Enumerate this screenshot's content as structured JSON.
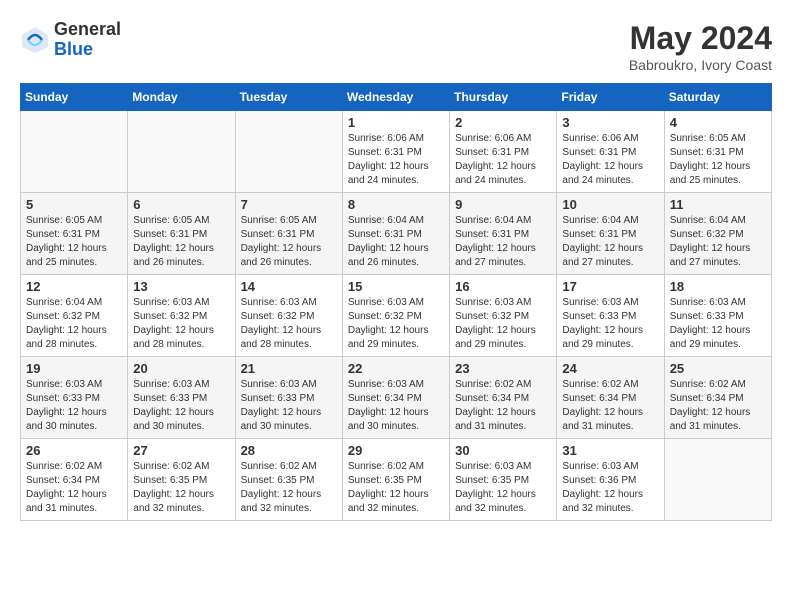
{
  "header": {
    "logo_general": "General",
    "logo_blue": "Blue",
    "month_year": "May 2024",
    "location": "Babroukro, Ivory Coast"
  },
  "weekdays": [
    "Sunday",
    "Monday",
    "Tuesday",
    "Wednesday",
    "Thursday",
    "Friday",
    "Saturday"
  ],
  "weeks": [
    [
      {
        "day": "",
        "info": ""
      },
      {
        "day": "",
        "info": ""
      },
      {
        "day": "",
        "info": ""
      },
      {
        "day": "1",
        "info": "Sunrise: 6:06 AM\nSunset: 6:31 PM\nDaylight: 12 hours\nand 24 minutes."
      },
      {
        "day": "2",
        "info": "Sunrise: 6:06 AM\nSunset: 6:31 PM\nDaylight: 12 hours\nand 24 minutes."
      },
      {
        "day": "3",
        "info": "Sunrise: 6:06 AM\nSunset: 6:31 PM\nDaylight: 12 hours\nand 24 minutes."
      },
      {
        "day": "4",
        "info": "Sunrise: 6:05 AM\nSunset: 6:31 PM\nDaylight: 12 hours\nand 25 minutes."
      }
    ],
    [
      {
        "day": "5",
        "info": "Sunrise: 6:05 AM\nSunset: 6:31 PM\nDaylight: 12 hours\nand 25 minutes."
      },
      {
        "day": "6",
        "info": "Sunrise: 6:05 AM\nSunset: 6:31 PM\nDaylight: 12 hours\nand 26 minutes."
      },
      {
        "day": "7",
        "info": "Sunrise: 6:05 AM\nSunset: 6:31 PM\nDaylight: 12 hours\nand 26 minutes."
      },
      {
        "day": "8",
        "info": "Sunrise: 6:04 AM\nSunset: 6:31 PM\nDaylight: 12 hours\nand 26 minutes."
      },
      {
        "day": "9",
        "info": "Sunrise: 6:04 AM\nSunset: 6:31 PM\nDaylight: 12 hours\nand 27 minutes."
      },
      {
        "day": "10",
        "info": "Sunrise: 6:04 AM\nSunset: 6:31 PM\nDaylight: 12 hours\nand 27 minutes."
      },
      {
        "day": "11",
        "info": "Sunrise: 6:04 AM\nSunset: 6:32 PM\nDaylight: 12 hours\nand 27 minutes."
      }
    ],
    [
      {
        "day": "12",
        "info": "Sunrise: 6:04 AM\nSunset: 6:32 PM\nDaylight: 12 hours\nand 28 minutes."
      },
      {
        "day": "13",
        "info": "Sunrise: 6:03 AM\nSunset: 6:32 PM\nDaylight: 12 hours\nand 28 minutes."
      },
      {
        "day": "14",
        "info": "Sunrise: 6:03 AM\nSunset: 6:32 PM\nDaylight: 12 hours\nand 28 minutes."
      },
      {
        "day": "15",
        "info": "Sunrise: 6:03 AM\nSunset: 6:32 PM\nDaylight: 12 hours\nand 29 minutes."
      },
      {
        "day": "16",
        "info": "Sunrise: 6:03 AM\nSunset: 6:32 PM\nDaylight: 12 hours\nand 29 minutes."
      },
      {
        "day": "17",
        "info": "Sunrise: 6:03 AM\nSunset: 6:33 PM\nDaylight: 12 hours\nand 29 minutes."
      },
      {
        "day": "18",
        "info": "Sunrise: 6:03 AM\nSunset: 6:33 PM\nDaylight: 12 hours\nand 29 minutes."
      }
    ],
    [
      {
        "day": "19",
        "info": "Sunrise: 6:03 AM\nSunset: 6:33 PM\nDaylight: 12 hours\nand 30 minutes."
      },
      {
        "day": "20",
        "info": "Sunrise: 6:03 AM\nSunset: 6:33 PM\nDaylight: 12 hours\nand 30 minutes."
      },
      {
        "day": "21",
        "info": "Sunrise: 6:03 AM\nSunset: 6:33 PM\nDaylight: 12 hours\nand 30 minutes."
      },
      {
        "day": "22",
        "info": "Sunrise: 6:03 AM\nSunset: 6:34 PM\nDaylight: 12 hours\nand 30 minutes."
      },
      {
        "day": "23",
        "info": "Sunrise: 6:02 AM\nSunset: 6:34 PM\nDaylight: 12 hours\nand 31 minutes."
      },
      {
        "day": "24",
        "info": "Sunrise: 6:02 AM\nSunset: 6:34 PM\nDaylight: 12 hours\nand 31 minutes."
      },
      {
        "day": "25",
        "info": "Sunrise: 6:02 AM\nSunset: 6:34 PM\nDaylight: 12 hours\nand 31 minutes."
      }
    ],
    [
      {
        "day": "26",
        "info": "Sunrise: 6:02 AM\nSunset: 6:34 PM\nDaylight: 12 hours\nand 31 minutes."
      },
      {
        "day": "27",
        "info": "Sunrise: 6:02 AM\nSunset: 6:35 PM\nDaylight: 12 hours\nand 32 minutes."
      },
      {
        "day": "28",
        "info": "Sunrise: 6:02 AM\nSunset: 6:35 PM\nDaylight: 12 hours\nand 32 minutes."
      },
      {
        "day": "29",
        "info": "Sunrise: 6:02 AM\nSunset: 6:35 PM\nDaylight: 12 hours\nand 32 minutes."
      },
      {
        "day": "30",
        "info": "Sunrise: 6:03 AM\nSunset: 6:35 PM\nDaylight: 12 hours\nand 32 minutes."
      },
      {
        "day": "31",
        "info": "Sunrise: 6:03 AM\nSunset: 6:36 PM\nDaylight: 12 hours\nand 32 minutes."
      },
      {
        "day": "",
        "info": ""
      }
    ]
  ]
}
